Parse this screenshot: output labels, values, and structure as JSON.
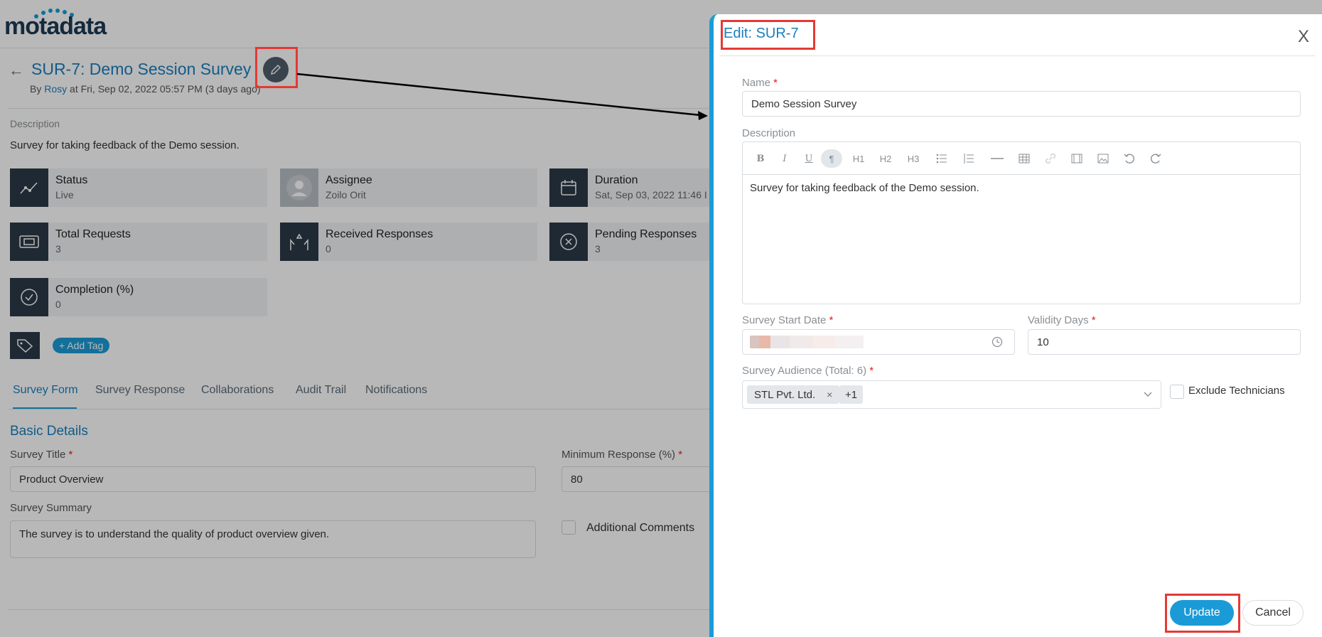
{
  "app": {
    "logo": "motadata"
  },
  "header": {
    "title": "SUR-7: Demo Session Survey",
    "by_prefix": "By",
    "user": "Rosy",
    "timestamp": "at Fri, Sep 02, 2022 05:57 PM (3 days ago)"
  },
  "description": {
    "label": "Description",
    "text": "Survey for taking feedback of the Demo session."
  },
  "cards": {
    "status": {
      "label": "Status",
      "value": "Live"
    },
    "assignee": {
      "label": "Assignee",
      "value": "Zoilo Orit"
    },
    "duration": {
      "label": "Duration",
      "value": "Sat, Sep 03, 2022 11:46 I"
    },
    "total_requests": {
      "label": "Total Requests",
      "value": "3"
    },
    "received": {
      "label": "Received Responses",
      "value": "0"
    },
    "pending": {
      "label": "Pending Responses",
      "value": "3"
    },
    "completion": {
      "label": "Completion (%)",
      "value": "0"
    }
  },
  "tags": {
    "add_label": "+ Add Tag"
  },
  "tabs": [
    {
      "label": "Survey Form"
    },
    {
      "label": "Survey Response"
    },
    {
      "label": "Collaborations"
    },
    {
      "label": "Audit Trail"
    },
    {
      "label": "Notifications"
    }
  ],
  "basic": {
    "title": "Basic Details",
    "survey_title_label": "Survey Title",
    "survey_title_value": "Product Overview",
    "min_response_label": "Minimum Response (%)",
    "min_response_value": "80",
    "summary_label": "Survey Summary",
    "summary_value": "The survey is to understand the quality of product overview given.",
    "additional_comments": "Additional Comments"
  },
  "drawer": {
    "title": "Edit: SUR-7",
    "close": "X",
    "name_label": "Name",
    "name_value": "Demo Session Survey",
    "description_label": "Description",
    "description_value": "Survey for taking feedback of the Demo session.",
    "toolbar": {
      "h1": "H1",
      "h2": "H2",
      "h3": "H3"
    },
    "start_date_label": "Survey Start Date",
    "validity_label": "Validity Days",
    "validity_value": "10",
    "audience_label": "Survey Audience (Total: 6)",
    "audience_chip": "STL Pvt. Ltd.",
    "audience_more": "+1",
    "exclude_label": "Exclude Technicians",
    "update_label": "Update",
    "cancel_label": "Cancel"
  },
  "colors": {
    "accent": "#1a9bd7",
    "title_blue": "#1a7fbf",
    "highlight_red": "#e53935",
    "card_icon_bg": "#2c3a47"
  }
}
